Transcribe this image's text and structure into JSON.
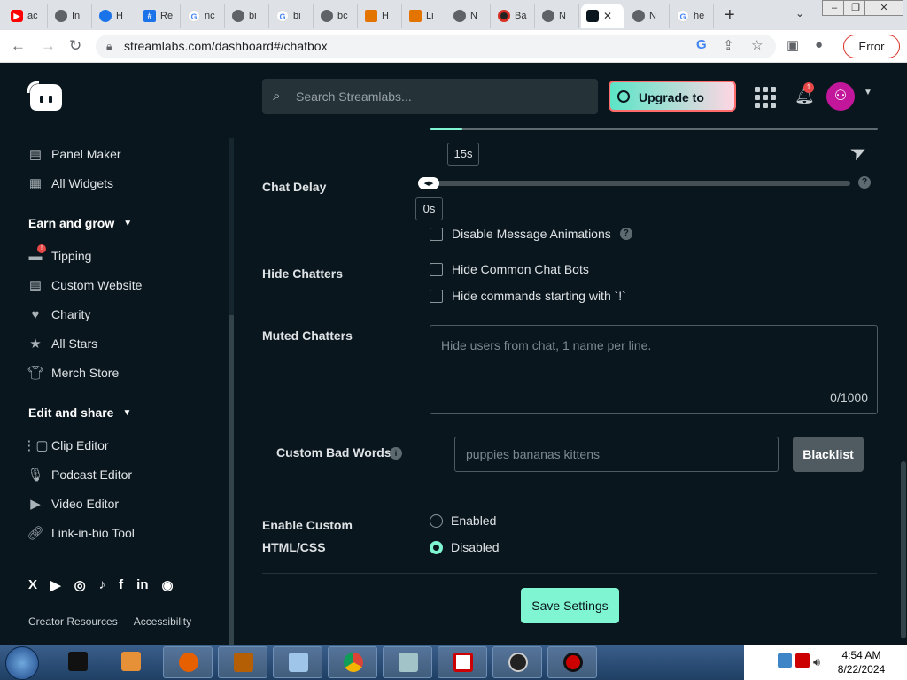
{
  "browser": {
    "tabs": [
      {
        "label": "ac",
        "icon": "youtube-icon",
        "color": "#ff0000"
      },
      {
        "label": "In",
        "icon": "globe-icon",
        "color": "#5f6368"
      },
      {
        "label": "H",
        "icon": "history-icon",
        "color": "#1a73e8"
      },
      {
        "label": "Re",
        "icon": "hash-icon",
        "color": "#1a73e8"
      },
      {
        "label": "nc",
        "icon": "google-icon",
        "color": "#4285f4"
      },
      {
        "label": "bi",
        "icon": "globe-icon",
        "color": "#5f6368"
      },
      {
        "label": "bi",
        "icon": "google-icon",
        "color": "#4285f4"
      },
      {
        "label": "bc",
        "icon": "globe-icon",
        "color": "#5f6368"
      },
      {
        "label": "H",
        "icon": "app-icon",
        "color": "#e37400"
      },
      {
        "label": "Li",
        "icon": "app-icon",
        "color": "#e37400"
      },
      {
        "label": "N",
        "icon": "shield-icon",
        "color": "#5f6368"
      },
      {
        "label": "Ba",
        "icon": "record-icon",
        "color": "#d93025"
      },
      {
        "label": "N",
        "icon": "shield-icon",
        "color": "#5f6368"
      },
      {
        "label": "",
        "icon": "streamlabs-icon",
        "color": "#09161d"
      },
      {
        "label": "N",
        "icon": "shield-icon",
        "color": "#5f6368"
      },
      {
        "label": "he",
        "icon": "google-icon",
        "color": "#4285f4"
      }
    ],
    "url": "streamlabs.com/dashboard#/chatbox",
    "error_label": "Error"
  },
  "sidebar": {
    "items_top": [
      {
        "label": "Panel Maker",
        "icon": "panel-icon"
      },
      {
        "label": "All Widgets",
        "icon": "widgets-icon"
      }
    ],
    "section_earn": "Earn and grow",
    "items_earn": [
      {
        "label": "Tipping",
        "icon": "tip-icon",
        "badge": "!"
      },
      {
        "label": "Custom Website",
        "icon": "website-icon"
      },
      {
        "label": "Charity",
        "icon": "heart-icon"
      },
      {
        "label": "All Stars",
        "icon": "star-icon"
      },
      {
        "label": "Merch Store",
        "icon": "shirt-icon"
      }
    ],
    "section_edit": "Edit and share",
    "items_edit": [
      {
        "label": "Clip Editor",
        "icon": "clip-icon"
      },
      {
        "label": "Podcast Editor",
        "icon": "microphone-icon"
      },
      {
        "label": "Video Editor",
        "icon": "play-icon"
      },
      {
        "label": "Link-in-bio Tool",
        "icon": "link-icon"
      }
    ],
    "socials": [
      "X",
      "▶",
      "◎",
      "♪",
      "f",
      "in",
      "◉"
    ],
    "footer": {
      "resources": "Creator Resources",
      "accessibility": "Accessibility"
    }
  },
  "topbar": {
    "search_placeholder": "Search Streamlabs...",
    "upgrade_label": "Upgrade to Ultra",
    "notification_count": "1"
  },
  "settings": {
    "upper_slider_value": "15s",
    "chat_delay": {
      "label": "Chat Delay",
      "value": "0s"
    },
    "disable_animations": {
      "label": "Disable Message Animations",
      "checked": false
    },
    "hide_chatters": {
      "label": "Hide Chatters",
      "options": [
        {
          "label": "Hide Common Chat Bots",
          "checked": false
        },
        {
          "label": "Hide commands starting with `!`",
          "checked": false
        }
      ]
    },
    "muted_chatters": {
      "label": "Muted Chatters",
      "placeholder": "Hide users from chat, 1 name per line.",
      "counter": "0/1000"
    },
    "custom_bad_words": {
      "label": "Custom Bad Words",
      "placeholder": "puppies bananas kittens",
      "button": "Blacklist"
    },
    "custom_html": {
      "label_line1": "Enable Custom",
      "label_line2": "HTML/CSS",
      "options": [
        {
          "label": "Enabled",
          "selected": false
        },
        {
          "label": "Disabled",
          "selected": true
        }
      ]
    },
    "save_label": "Save Settings"
  },
  "taskbar": {
    "time": "4:54 AM",
    "date": "8/22/2024"
  },
  "colors": {
    "background": "#09161d",
    "accent": "#80f5d2",
    "alert": "#e64848"
  }
}
